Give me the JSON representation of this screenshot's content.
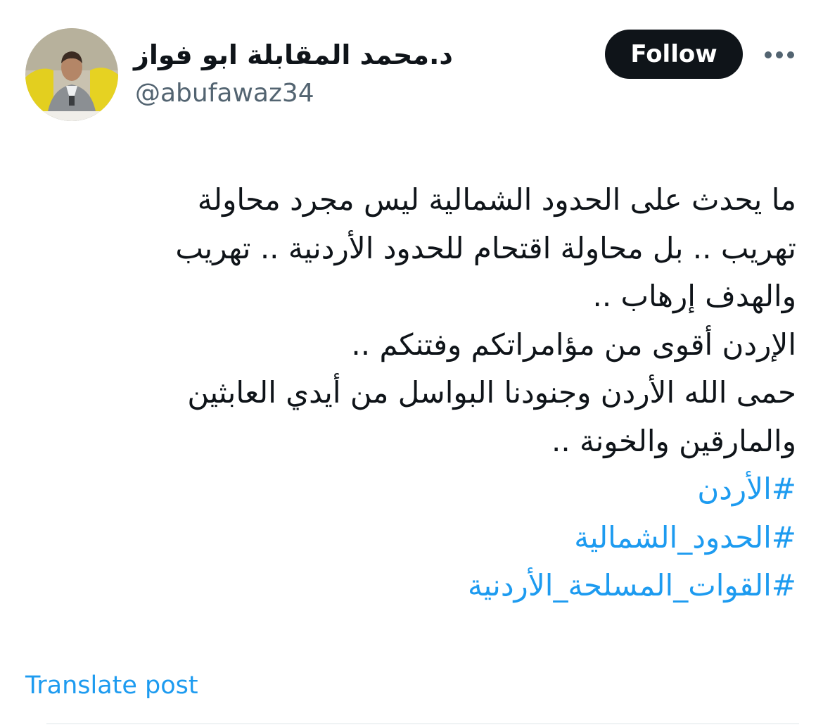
{
  "profile": {
    "display_name": "د.محمد المقابلة ابو فواز",
    "handle": "@abufawaz34",
    "avatar_icon": "profile-photo"
  },
  "actions": {
    "follow_label": "Follow",
    "more_icon": "more-horizontal-icon"
  },
  "tweet": {
    "lines": [
      "ما يحدث على الحدود الشمالية ليس مجرد محاولة",
      "تهريب .. بل محاولة اقتحام للحدود الأردنية .. تهريب",
      "والهدف إرهاب ..",
      "الإردن أقوى من مؤامراتكم وفتنكم ..",
      "حمى الله الأردن وجنودنا البواسل من أيدي العابثين",
      "والمارقين والخونة .."
    ],
    "hashtags": [
      "#الأردن",
      "#الحدود_الشمالية",
      "#القوات_المسلحة_الأردنية"
    ]
  },
  "translate_label": "Translate post",
  "colors": {
    "text": "#0f1419",
    "secondary": "#536471",
    "link": "#1d9bf0",
    "button_bg": "#0f1419",
    "divider": "#eff3f4"
  }
}
